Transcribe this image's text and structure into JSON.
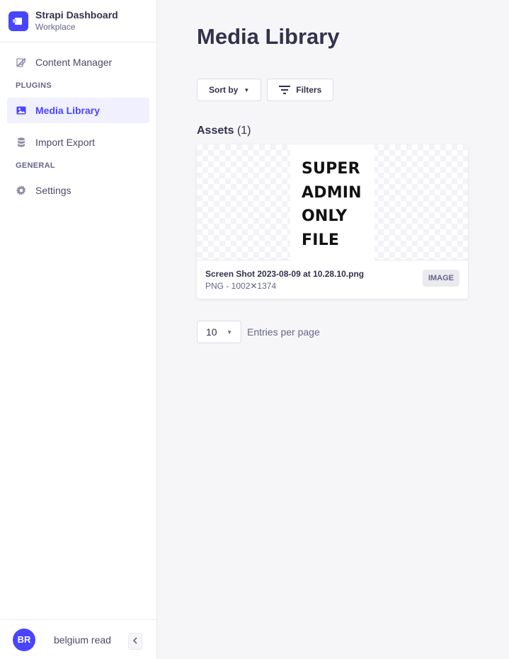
{
  "brand": {
    "title": "Strapi Dashboard",
    "subtitle": "Workplace",
    "accent": "#4945ff"
  },
  "sidebar": {
    "items": [
      {
        "label": "Content Manager",
        "icon": "feather-icon"
      },
      {
        "label": "Media Library",
        "icon": "image-icon",
        "active": true
      },
      {
        "label": "Import Export",
        "icon": "database-icon"
      },
      {
        "label": "Settings",
        "icon": "gear-icon"
      }
    ],
    "sections": {
      "plugins": "PLUGINS",
      "general": "GENERAL"
    }
  },
  "user": {
    "initials": "BR",
    "name": "belgium read"
  },
  "main": {
    "title": "Media Library",
    "sort_label": "Sort by",
    "filters_label": "Filters",
    "assets_heading": "Assets",
    "assets_count": "(1)",
    "asset": {
      "name": "Screen Shot 2023-08-09 at 10.28.10.png",
      "meta": "PNG - 1002✕1374",
      "badge": "IMAGE",
      "preview_lines": [
        "SUPER",
        "ADMIN",
        "ONLY",
        "FILE"
      ]
    },
    "pagination": {
      "page_size": "10",
      "label": "Entries per page"
    }
  }
}
